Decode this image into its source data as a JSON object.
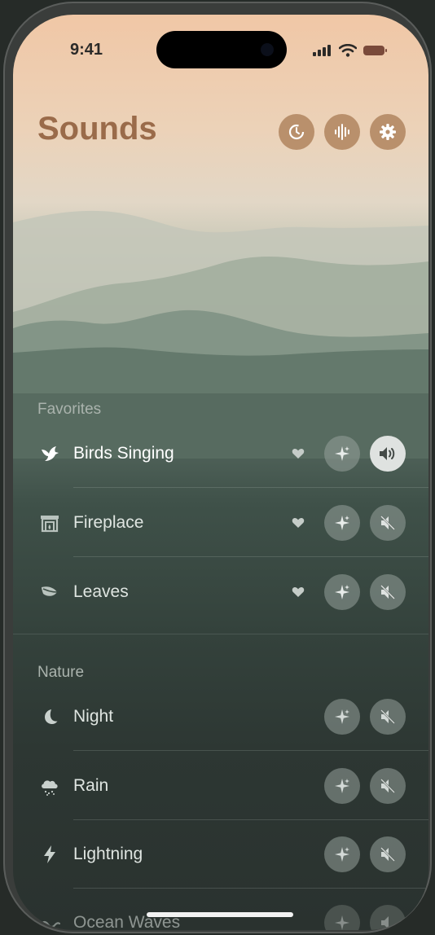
{
  "status_bar": {
    "time": "9:41"
  },
  "header": {
    "title": "Sounds",
    "buttons": [
      {
        "icon": "timer-icon"
      },
      {
        "icon": "waveform-icon"
      },
      {
        "icon": "gear-icon"
      }
    ]
  },
  "sections": [
    {
      "title": "Favorites",
      "items": [
        {
          "label": "Birds Singing",
          "icon": "bird-icon",
          "favorite": true,
          "volume": "on"
        },
        {
          "label": "Fireplace",
          "icon": "fireplace-icon",
          "favorite": true,
          "volume": "muted"
        },
        {
          "label": "Leaves",
          "icon": "leaf-icon",
          "favorite": true,
          "volume": "muted"
        }
      ]
    },
    {
      "title": "Nature",
      "items": [
        {
          "label": "Night",
          "icon": "moon-icon",
          "favorite": false,
          "volume": "muted"
        },
        {
          "label": "Rain",
          "icon": "rain-cloud-icon",
          "favorite": false,
          "volume": "muted"
        },
        {
          "label": "Lightning",
          "icon": "bolt-icon",
          "favorite": false,
          "volume": "muted"
        },
        {
          "label": "Ocean Waves",
          "icon": "wave-icon",
          "favorite": false,
          "volume": "muted"
        }
      ]
    }
  ],
  "colors": {
    "accent": "#b9906c",
    "title": "#9a6b4a",
    "text": "#dfe5e1"
  }
}
